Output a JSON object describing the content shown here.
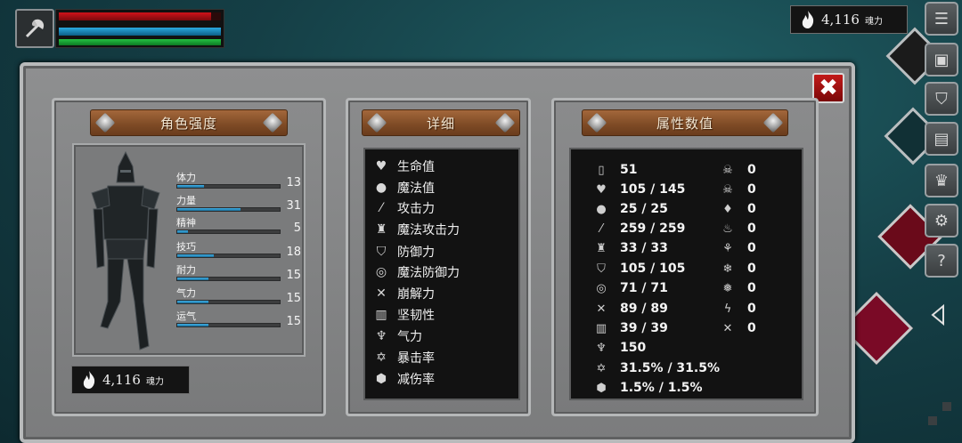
{
  "hud": {
    "portrait_icon": "axe-icon",
    "hp_fraction": 0.94,
    "mp_fraction": 1.0,
    "stamina_fraction": 1.0,
    "soul_value": "4,116",
    "soul_unit": "魂力",
    "colors": {
      "hp": "#d0121a",
      "mp": "#2aa8e0",
      "stamina": "#25c043"
    }
  },
  "right_menu": {
    "items": [
      {
        "name": "menu-list-icon"
      },
      {
        "name": "backpack-icon"
      },
      {
        "name": "armor-icon"
      },
      {
        "name": "book-icon"
      },
      {
        "name": "crown-icon"
      },
      {
        "name": "settings-icon"
      },
      {
        "name": "help-icon"
      }
    ]
  },
  "panels": {
    "character": {
      "title": "角色强度",
      "stats": [
        {
          "label": "体力",
          "value": "13",
          "fraction": 0.26
        },
        {
          "label": "力量",
          "value": "31",
          "fraction": 0.62
        },
        {
          "label": "精神",
          "value": "5",
          "fraction": 0.1
        },
        {
          "label": "技巧",
          "value": "18",
          "fraction": 0.36
        },
        {
          "label": "耐力",
          "value": "15",
          "fraction": 0.3
        },
        {
          "label": "气力",
          "value": "15",
          "fraction": 0.3
        },
        {
          "label": "运气",
          "value": "15",
          "fraction": 0.3
        }
      ],
      "soul_value": "4,116",
      "soul_unit": "魂力"
    },
    "detail": {
      "title": "详细",
      "items": [
        {
          "icon": "heart-icon",
          "label": "生命值"
        },
        {
          "icon": "brain-icon",
          "label": "魔法值"
        },
        {
          "icon": "sword-icon",
          "label": "攻击力"
        },
        {
          "icon": "magic-attack-icon",
          "label": "魔法攻击力"
        },
        {
          "icon": "shield-icon",
          "label": "防御力"
        },
        {
          "icon": "magic-shield-icon",
          "label": "魔法防御力"
        },
        {
          "icon": "break-icon",
          "label": "崩解力"
        },
        {
          "icon": "helmet-icon",
          "label": "坚韧性"
        },
        {
          "icon": "lungs-icon",
          "label": "气力"
        },
        {
          "icon": "crit-star-icon",
          "label": "暴击率"
        },
        {
          "icon": "damage-reduce-icon",
          "label": "减伤率"
        }
      ]
    },
    "attributes": {
      "title": "属性数值",
      "left": [
        {
          "icon": "level-icon",
          "value": "51"
        },
        {
          "icon": "heart-icon",
          "value": "105 / 145"
        },
        {
          "icon": "brain-icon",
          "value": "25 / 25"
        },
        {
          "icon": "sword-icon",
          "value": "259 / 259"
        },
        {
          "icon": "magic-attack-icon",
          "value": "33 / 33"
        },
        {
          "icon": "shield-icon",
          "value": "105 / 105"
        },
        {
          "icon": "magic-shield-icon",
          "value": "71 / 71"
        },
        {
          "icon": "break-icon",
          "value": "89 / 89"
        },
        {
          "icon": "helmet-icon",
          "value": "39 / 39"
        },
        {
          "icon": "lungs-icon",
          "value": "150"
        },
        {
          "icon": "crit-star-icon",
          "value": "31.5% / 31.5%"
        },
        {
          "icon": "damage-reduce-icon",
          "value": "1.5% / 1.5%"
        }
      ],
      "right": [
        {
          "icon": "poison-skull-icon",
          "value": "0"
        },
        {
          "icon": "curse-skull-icon",
          "value": "0"
        },
        {
          "icon": "bleed-drop-icon",
          "value": "0"
        },
        {
          "icon": "fire-icon",
          "value": "0"
        },
        {
          "icon": "burn-icon",
          "value": "0"
        },
        {
          "icon": "frost-icon",
          "value": "0"
        },
        {
          "icon": "ice-icon",
          "value": "0"
        },
        {
          "icon": "lightning-icon",
          "value": "0"
        },
        {
          "icon": "dark-icon",
          "value": "0"
        }
      ]
    }
  }
}
